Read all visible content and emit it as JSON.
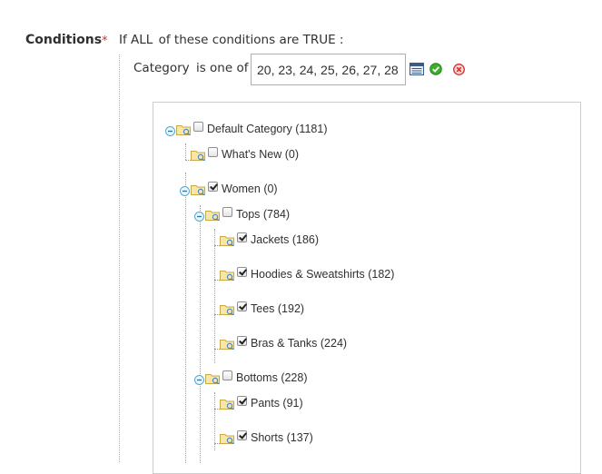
{
  "condition": {
    "label": "Conditions",
    "required_mark": "*",
    "lead": "If",
    "aggregator": "ALL",
    "middle": "of these conditions are",
    "value": "TRUE",
    "trail": ":"
  },
  "rule": {
    "attribute": "Category",
    "operator": "is one of",
    "value": "20, 23, 24, 25, 26, 27, 28"
  },
  "colors": {
    "required": "#e22626",
    "apply": "#3cae2b",
    "remove": "#d9302c"
  },
  "tree": [
    {
      "label": "Default Category (1181)",
      "checked": false,
      "expanded": true
    },
    {
      "label": "What's New (0)",
      "checked": false
    },
    {
      "label": "Women (0)",
      "checked": true,
      "expanded": true
    },
    {
      "label": "Tops (784)",
      "checked": false,
      "expanded": true
    },
    {
      "label": "Jackets (186)",
      "checked": true
    },
    {
      "label": "Hoodies & Sweatshirts (182)",
      "checked": true
    },
    {
      "label": "Tees (192)",
      "checked": true
    },
    {
      "label": "Bras & Tanks (224)",
      "checked": true
    },
    {
      "label": "Bottoms (228)",
      "checked": false,
      "expanded": true
    },
    {
      "label": "Pants (91)",
      "checked": true
    },
    {
      "label": "Shorts (137)",
      "checked": true
    }
  ]
}
